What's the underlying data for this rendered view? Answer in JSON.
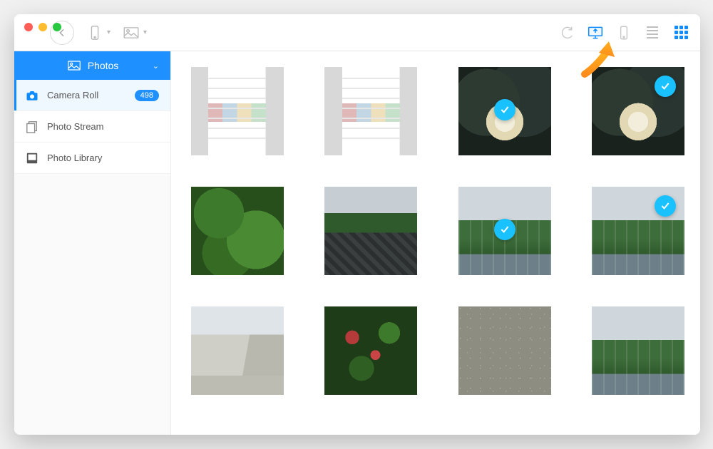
{
  "colors": {
    "accent": "#1f90ff",
    "select": "#19c2ff"
  },
  "toolbar": {
    "icons": {
      "back": "back-arrow-icon",
      "device": "device-icon",
      "picture": "picture-icon",
      "refresh": "refresh-icon",
      "to_computer": "export-computer-icon",
      "to_device": "export-device-icon",
      "list_view": "list-view-icon",
      "grid_view": "grid-view-icon"
    },
    "active_view": "grid"
  },
  "sidebar": {
    "header": {
      "label": "Photos",
      "icon": "picture-icon"
    },
    "items": [
      {
        "label": "Camera Roll",
        "icon": "camera-icon",
        "badge": "498",
        "active": true
      },
      {
        "label": "Photo Stream",
        "icon": "stack-icon",
        "active": false
      },
      {
        "label": "Photo Library",
        "icon": "polaroid-icon",
        "active": false
      }
    ]
  },
  "grid": {
    "items": [
      {
        "kind": "screenshot",
        "selected": false
      },
      {
        "kind": "screenshot",
        "selected": false
      },
      {
        "kind": "flower",
        "selected": true,
        "check_pos": "center"
      },
      {
        "kind": "flower",
        "selected": true,
        "check_pos": "top-right"
      },
      {
        "kind": "green",
        "selected": false
      },
      {
        "kind": "water",
        "selected": false
      },
      {
        "kind": "building",
        "selected": true,
        "check_pos": "center"
      },
      {
        "kind": "building",
        "selected": true,
        "check_pos": "top-right"
      },
      {
        "kind": "plaza",
        "selected": false
      },
      {
        "kind": "leaves",
        "selected": false
      },
      {
        "kind": "gravel",
        "selected": false
      },
      {
        "kind": "building",
        "selected": false
      }
    ]
  },
  "annotation": {
    "label": "export-to-computer highlighted"
  }
}
